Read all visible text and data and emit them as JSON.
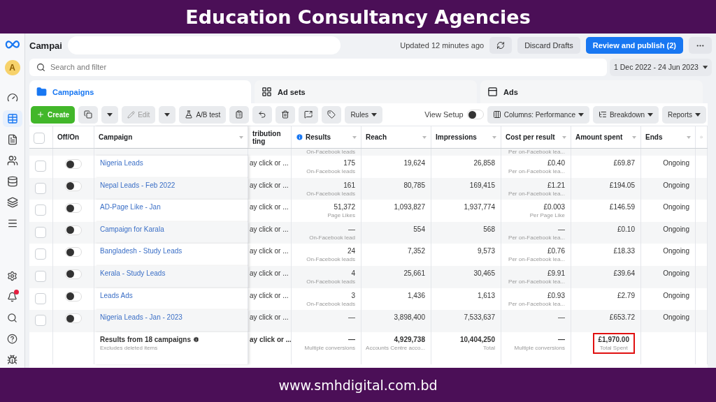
{
  "banner": {
    "title": "Education Consultancy Agencies",
    "footer": "www.smhdigital.com.bd"
  },
  "sidebar": {
    "avatar": "A",
    "items": [
      {
        "kind": "gauge",
        "selected": false
      },
      {
        "kind": "table",
        "selected": true
      },
      {
        "kind": "doc",
        "selected": false
      },
      {
        "kind": "people",
        "selected": false
      },
      {
        "kind": "database",
        "selected": false
      },
      {
        "kind": "layers",
        "selected": false
      },
      {
        "kind": "menu",
        "selected": false
      }
    ],
    "bottom": [
      {
        "kind": "settings",
        "badge": false
      },
      {
        "kind": "bell",
        "badge": true
      },
      {
        "kind": "search",
        "badge": false
      },
      {
        "kind": "help",
        "badge": false
      },
      {
        "kind": "bug",
        "badge": false
      }
    ]
  },
  "select_all_checked": false,
  "header": {
    "title": "Campai",
    "updated": "Updated 12 minutes ago",
    "discard": "Discard Drafts",
    "publish": "Review and publish (2)"
  },
  "search": {
    "placeholder": "Search and filter"
  },
  "date_range": "1 Dec 2022 - 24 Jun 2023",
  "tabs": [
    {
      "label": "Campaigns",
      "kind": "folder",
      "selected": true
    },
    {
      "label": "Ad sets",
      "kind": "grid",
      "selected": false
    },
    {
      "label": "Ads",
      "kind": "window",
      "selected": false
    }
  ],
  "toolbar": {
    "create": "Create",
    "edit": "Edit",
    "edit_disabled": true,
    "ab_test": "A/B test",
    "rules": "Rules",
    "view_setup": "View Setup",
    "view_setup_on": false,
    "columns": "Columns: Performance",
    "breakdown": "Breakdown",
    "reports": "Reports"
  },
  "columns": {
    "off_on": "Off/On",
    "campaign": "Campaign",
    "attribution": [
      "tribution",
      "ting"
    ],
    "results": "Results",
    "reach": "Reach",
    "impressions": "Impressions",
    "cost": "Cost per result",
    "amount": "Amount spent",
    "ends": "Ends"
  },
  "partial_row": {
    "results_note": "On-Facebook leads",
    "cost_note": "Per on-Facebook lea..."
  },
  "rows": [
    {
      "checked": false,
      "on": false,
      "campaign": "Nigeria Leads",
      "attribution": "ay click or ...",
      "results": "175",
      "results_note": "On-Facebook leads",
      "reach": "19,624",
      "impressions": "26,858",
      "cost": "£0.40",
      "cost_note": "Per on-Facebook lea...",
      "amount": "£69.87",
      "ends": "Ongoing"
    },
    {
      "checked": false,
      "on": false,
      "campaign": "Nepal Leads - Feb 2022",
      "attribution": "ay click or ...",
      "results": "161",
      "results_note": "On-Facebook leads",
      "reach": "80,785",
      "impressions": "169,415",
      "cost": "£1.21",
      "cost_note": "Per on-Facebook lea...",
      "amount": "£194.05",
      "ends": "Ongoing"
    },
    {
      "checked": false,
      "on": false,
      "campaign": "AD-Page Like - Jan",
      "attribution": "ay click or ...",
      "results": "51,372",
      "results_note": "Page Likes",
      "reach": "1,093,827",
      "impressions": "1,937,774",
      "cost": "£0.003",
      "cost_note": "Per Page Like",
      "amount": "£146.59",
      "ends": "Ongoing"
    },
    {
      "checked": false,
      "on": false,
      "campaign": "Campaign for Karala",
      "attribution": "ay click or ...",
      "results": "—",
      "results_note": "On-Facebook lead",
      "reach": "554",
      "impressions": "568",
      "cost": "—",
      "cost_note": "Per on-Facebook lea...",
      "amount": "£0.10",
      "ends": "Ongoing"
    },
    {
      "checked": false,
      "on": false,
      "campaign": "Bangladesh - Study Leads",
      "attribution": "ay click or ...",
      "results": "24",
      "results_note": "On-Facebook leads",
      "reach": "7,352",
      "impressions": "9,573",
      "cost": "£0.76",
      "cost_note": "Per on-Facebook lea...",
      "amount": "£18.33",
      "ends": "Ongoing"
    },
    {
      "checked": false,
      "on": false,
      "campaign": "Kerala - Study Leads",
      "attribution": "ay click or ...",
      "results": "4",
      "results_note": "On-Facebook leads",
      "reach": "25,661",
      "impressions": "30,465",
      "cost": "£9.91",
      "cost_note": "Per on-Facebook lea...",
      "amount": "£39.64",
      "ends": "Ongoing"
    },
    {
      "checked": false,
      "on": false,
      "campaign": "Leads Ads",
      "attribution": "ay click or ...",
      "results": "3",
      "results_note": "On-Facebook leads",
      "reach": "1,436",
      "impressions": "1,613",
      "cost": "£0.93",
      "cost_note": "Per on-Facebook lea...",
      "amount": "£2.79",
      "ends": "Ongoing"
    },
    {
      "checked": false,
      "on": false,
      "campaign": "Nigeria Leads - Jan - 2023",
      "attribution": "ay click or ...",
      "results": "—",
      "reach": "3,898,400",
      "impressions": "7,533,637",
      "cost": "—",
      "amount": "£653.72",
      "ends": "Ongoing"
    }
  ],
  "totals": {
    "campaign": "Results from 18 campaigns",
    "campaign_note": "Excludes deleted items",
    "attribution": "ay click or ...",
    "results": "—",
    "results_note": "Multiple conversions",
    "reach": "4,929,738",
    "reach_note": "Accounts Centre acco...",
    "impressions": "10,404,250",
    "impressions_note": "Total",
    "cost": "—",
    "cost_note": "Multiple conversions",
    "amount": "£1,970.00",
    "amount_note": "Total Spent",
    "amount_highlighted": true
  }
}
